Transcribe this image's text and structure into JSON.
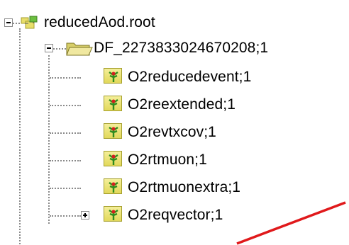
{
  "tree": {
    "root": {
      "label": "reducedAod.root",
      "icon": "root-file-icon",
      "expanded": true
    },
    "directory": {
      "label": "DF_2273833024670208;1",
      "icon": "open-folder-icon",
      "expanded": true
    },
    "tables": [
      {
        "label": "O2reducedevent;1",
        "icon": "ttree-icon"
      },
      {
        "label": "O2reextended;1",
        "icon": "ttree-icon"
      },
      {
        "label": "O2revtxcov;1",
        "icon": "ttree-icon"
      },
      {
        "label": "O2rtmuon;1",
        "icon": "ttree-icon"
      },
      {
        "label": "O2rtmuonextra;1",
        "icon": "ttree-icon"
      },
      {
        "label": "O2reqvector;1",
        "icon": "ttree-icon",
        "collapsed": true
      }
    ]
  },
  "colors": {
    "tree_icon_fill": "#e8de6a",
    "annotation_arrow": "#e0191b"
  }
}
